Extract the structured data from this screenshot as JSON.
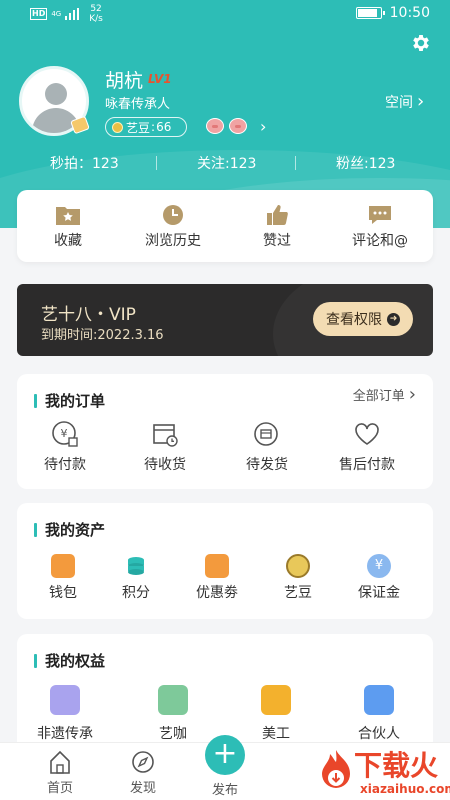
{
  "status_bar": {
    "hd": "HD",
    "network": "4G",
    "speed_value": "52",
    "speed_unit": "K/s",
    "time": "10:50",
    "battery_level": 0.9
  },
  "profile": {
    "name": "胡杭",
    "level": "LV1",
    "title": "咏春传承人",
    "beans_label": "艺豆",
    "beans_sep": ":",
    "beans_value": "66",
    "space_label": "空间"
  },
  "stats": {
    "seconds_label": "秒拍",
    "seconds_value": "123",
    "follow_label": "关注",
    "follow_value": "123",
    "fans_label": "粉丝",
    "fans_value": "123"
  },
  "quick_actions": [
    {
      "label": "收藏",
      "icon": "star-folder-icon"
    },
    {
      "label": "浏览历史",
      "icon": "clock-icon"
    },
    {
      "label": "赞过",
      "icon": "thumbs-up-icon"
    },
    {
      "label": "评论和@",
      "icon": "comment-icon"
    }
  ],
  "vip": {
    "title": "艺十八・VIP",
    "expire": "到期时间:2022.3.16",
    "button": "查看权限"
  },
  "orders": {
    "title": "我的订单",
    "all_label": "全部订单",
    "items": [
      {
        "label": "待付款",
        "icon": "payment-pending-icon"
      },
      {
        "label": "待收货",
        "icon": "receive-pending-icon"
      },
      {
        "label": "待发货",
        "icon": "ship-pending-icon"
      },
      {
        "label": "售后付款",
        "icon": "after-sales-heart-icon"
      }
    ]
  },
  "assets": {
    "title": "我的资产",
    "items": [
      {
        "label": "钱包",
        "icon": "wallet-icon"
      },
      {
        "label": "积分",
        "icon": "points-coins-icon"
      },
      {
        "label": "优惠劵",
        "icon": "coupon-icon"
      },
      {
        "label": "艺豆",
        "icon": "bean-coin-icon"
      },
      {
        "label": "保证金",
        "icon": "deposit-yen-icon"
      }
    ]
  },
  "rights": {
    "title": "我的权益",
    "items": [
      {
        "label": "非遗传承",
        "icon": "heritage-icon"
      },
      {
        "label": "艺咖",
        "icon": "artist-icon"
      },
      {
        "label": "美工",
        "icon": "design-icon"
      },
      {
        "label": "合伙人",
        "icon": "partner-handshake-icon"
      }
    ]
  },
  "bottom_nav": {
    "home": "首页",
    "discover": "发现",
    "publish": "发布"
  },
  "watermark": {
    "text": "下载火",
    "url": "xiazaihuo.com"
  },
  "colors": {
    "primary": "#2dbdb6",
    "vip_bg": "#2c2b2b",
    "vip_gold": "#f3dcb3",
    "level": "#e8542f",
    "watermark": "#e9462a"
  }
}
